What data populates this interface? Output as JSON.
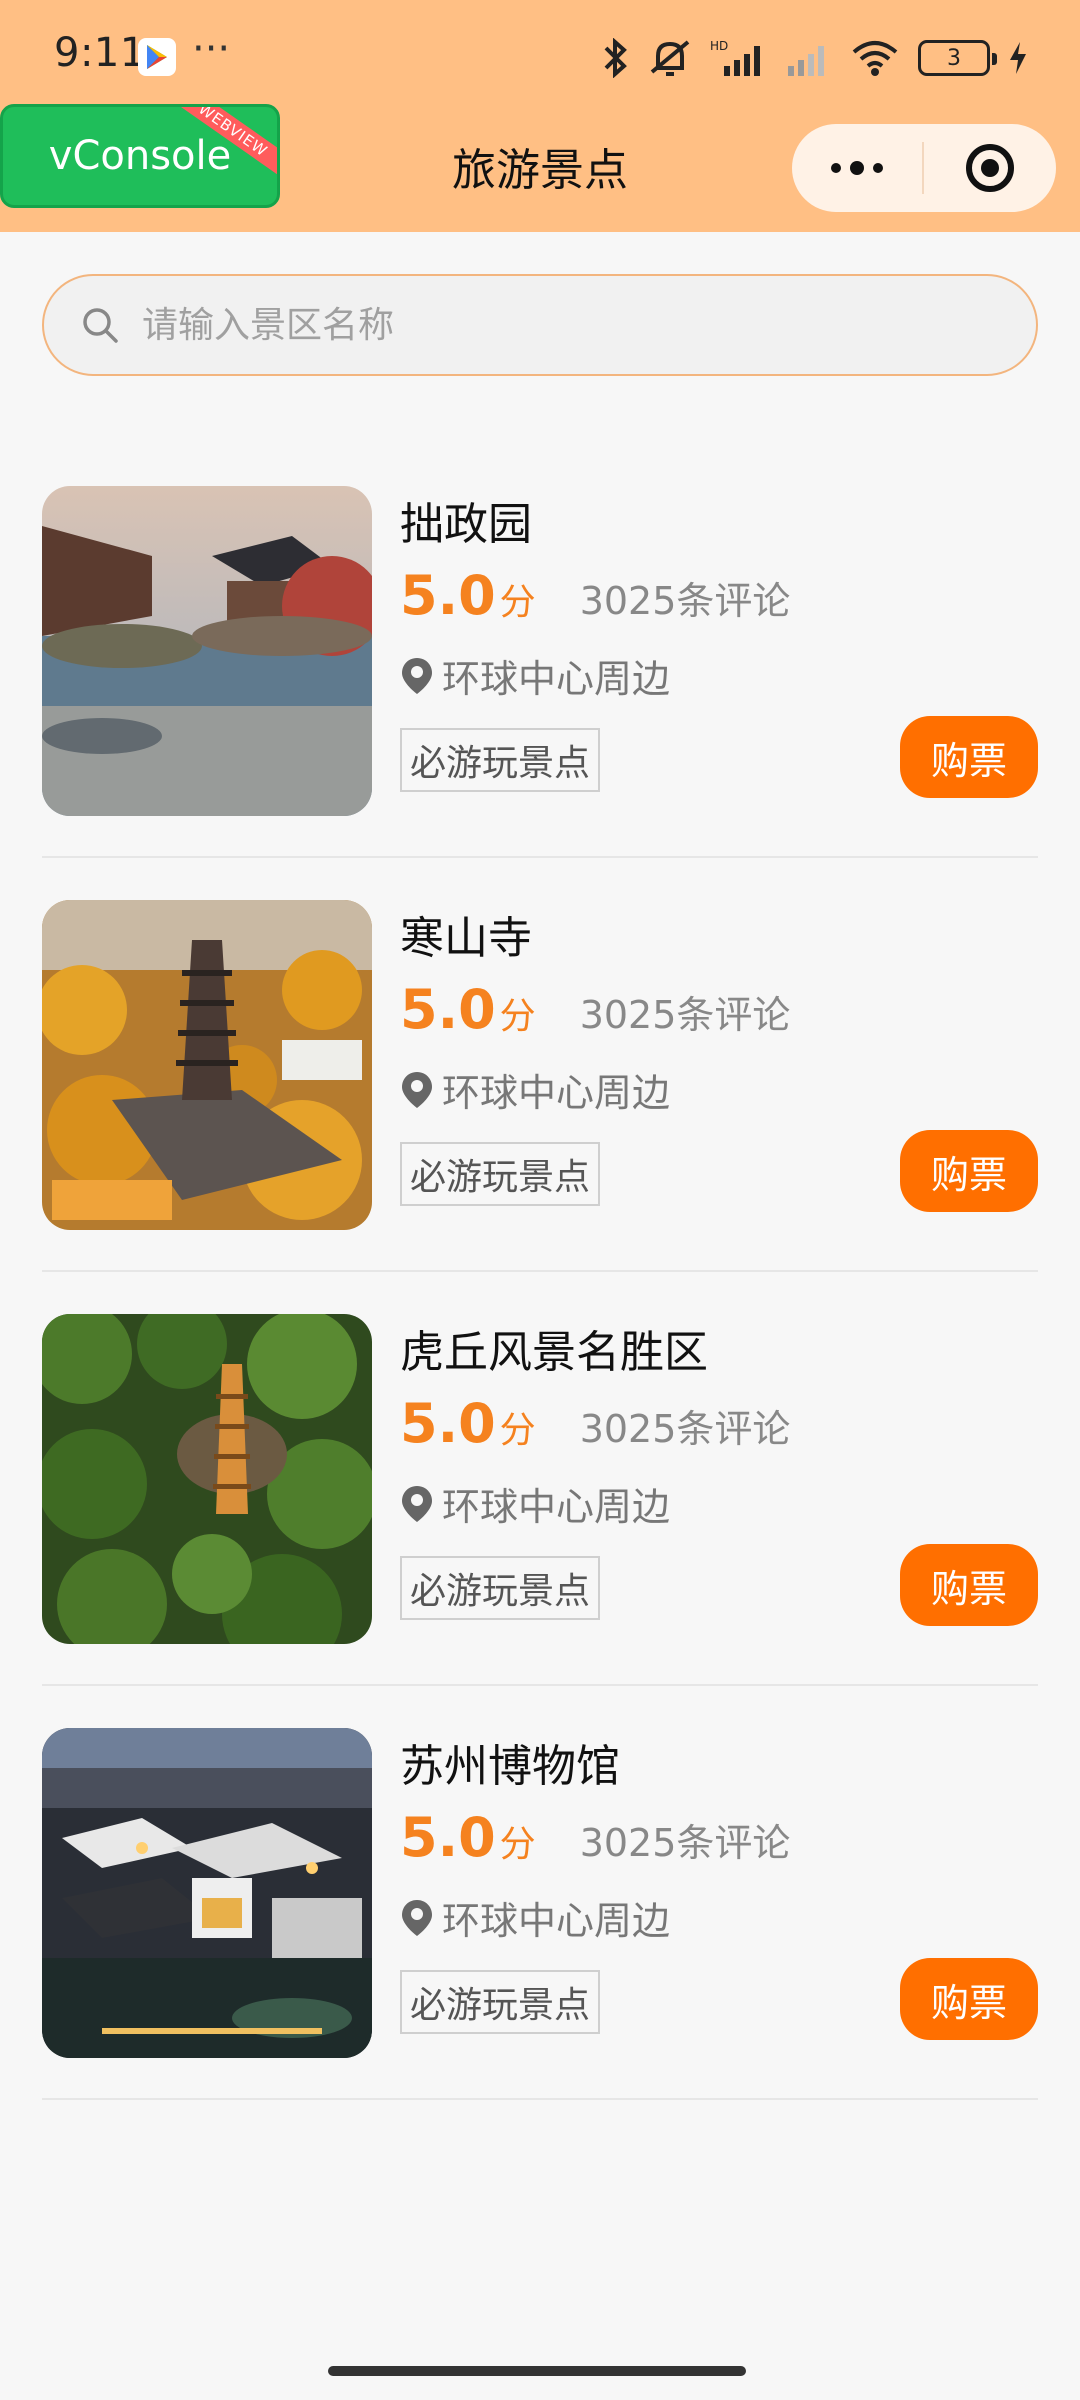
{
  "status_bar": {
    "time": "9:11",
    "more_dots": "···",
    "battery_level": "3",
    "hd_label": "HD"
  },
  "header": {
    "vconsole_label": "vConsole",
    "vconsole_ribbon": "WEBVIEW",
    "title": "旅游景点"
  },
  "search": {
    "placeholder": "请输入景区名称",
    "value": ""
  },
  "colors": {
    "header_bg": "#ffbf84",
    "accent": "#f5821f",
    "buy_button": "#ff6f00",
    "vconsole": "#1fbe5a"
  },
  "attractions": [
    {
      "name": "拙政园",
      "score": "5.0",
      "score_unit": "分",
      "reviews": "3025条评论",
      "location": "环球中心周边",
      "tag": "必游玩景点",
      "buy_label": "购票",
      "image": "garden-pond-image"
    },
    {
      "name": "寒山寺",
      "score": "5.0",
      "score_unit": "分",
      "reviews": "3025条评论",
      "location": "环球中心周边",
      "tag": "必游玩景点",
      "buy_label": "购票",
      "image": "temple-pagoda-autumn-image"
    },
    {
      "name": "虎丘风景名胜区",
      "score": "5.0",
      "score_unit": "分",
      "reviews": "3025条评论",
      "location": "环球中心周边",
      "tag": "必游玩景点",
      "buy_label": "购票",
      "image": "tiger-hill-pagoda-image"
    },
    {
      "name": "苏州博物馆",
      "score": "5.0",
      "score_unit": "分",
      "reviews": "3025条评论",
      "location": "环球中心周边",
      "tag": "必游玩景点",
      "buy_label": "购票",
      "image": "museum-night-image"
    }
  ]
}
